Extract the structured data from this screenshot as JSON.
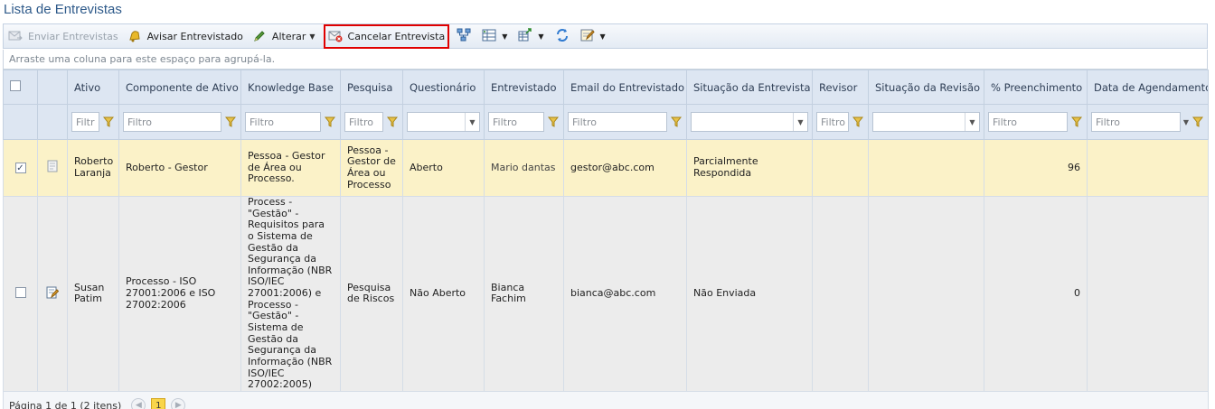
{
  "page": {
    "title": "Lista de Entrevistas"
  },
  "toolbar": {
    "send_label": "Enviar Entrevistas",
    "notify_label": "Avisar Entrevistado",
    "alter_label": "Alterar",
    "cancel_label": "Cancelar Entrevista",
    "highlight_color": "#e00000"
  },
  "group_panel": {
    "text": "Arraste uma coluna para este espaço para agrupá-la."
  },
  "columns": {
    "ativo": "Ativo",
    "componente": "Componente de Ativo",
    "kb": "Knowledge Base",
    "pesquisa": "Pesquisa",
    "questionario": "Questionário",
    "entrevistado": "Entrevistado",
    "email": "Email do Entrevistado",
    "situacao": "Situação da Entrevista",
    "revisor": "Revisor",
    "situacao_revisao": "Situação da Revisão",
    "preenchimento": "% Preenchimento",
    "agendamento": "Data de Agendamento"
  },
  "filters": {
    "ativo": "Filtr",
    "componente": "Filtro",
    "kb": "Filtro",
    "pesquisa": "Filtro",
    "entrevistado": "Filtro",
    "email": "Filtro",
    "revisor": "Filtro",
    "preenchimento": "Filtro",
    "agendamento": "Filtro"
  },
  "rows": [
    {
      "selected": true,
      "ativo": "Roberto Laranja",
      "componente": "Roberto - Gestor",
      "kb": "Pessoa - Gestor de Área ou Processo.",
      "pesquisa": "Pessoa - Gestor de Área ou Processo",
      "questionario": "Aberto",
      "entrevistado": "Mario dantas",
      "email": "gestor@abc.com",
      "situacao": "Parcialmente Respondida",
      "revisor": "",
      "situacao_revisao": "",
      "preenchimento": "96",
      "agendamento": ""
    },
    {
      "selected": false,
      "ativo": "Susan Patim",
      "componente": "Processo - ISO 27001:2006 e ISO 27002:2006",
      "kb": "Process - \"Gestão\" - Requisitos para o Sistema de Gestão da Segurança da Informação (NBR ISO/IEC 27001:2006) e Processo - \"Gestão\" - Sistema de Gestão da Segurança da Informação (NBR ISO/IEC 27002:2005)",
      "pesquisa": "Pesquisa de Riscos",
      "questionario": "Não Aberto",
      "entrevistado": "Bianca Fachim",
      "email": "bianca@abc.com",
      "situacao": "Não Enviada",
      "revisor": "",
      "situacao_revisao": "",
      "preenchimento": "0",
      "agendamento": ""
    }
  ],
  "pager": {
    "summary": "Página 1 de 1 (2 itens)",
    "current_page": "1"
  }
}
